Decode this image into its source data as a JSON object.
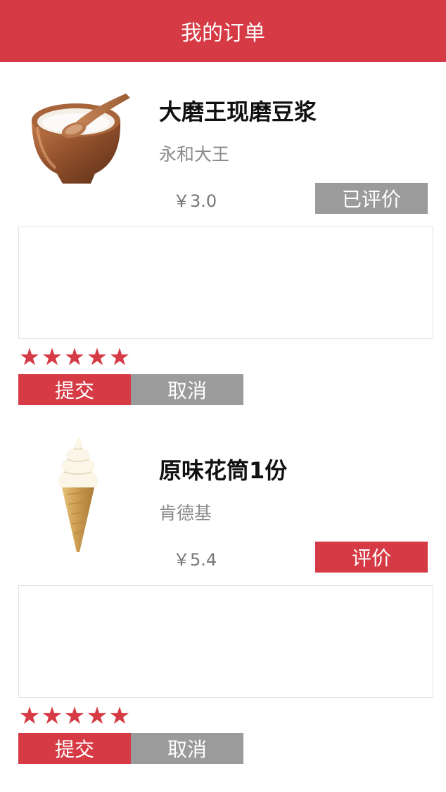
{
  "header": {
    "title": "我的订单"
  },
  "orders": [
    {
      "name": "大磨王现磨豆浆",
      "shop": "永和大王",
      "price": "￥3.0",
      "review_button": "已评价",
      "review_state": "reviewed",
      "comment_value": "",
      "rating": 5,
      "stars": [
        "★",
        "★",
        "★",
        "★",
        "★"
      ],
      "submit_label": "提交",
      "cancel_label": "取消",
      "image_icon": "soy-milk-bowl-image"
    },
    {
      "name": "原味花筒1份",
      "shop": "肯德基",
      "price": "￥5.4",
      "review_button": "评价",
      "review_state": "pending",
      "comment_value": "",
      "rating": 5,
      "stars": [
        "★",
        "★",
        "★",
        "★",
        "★"
      ],
      "submit_label": "提交",
      "cancel_label": "取消",
      "image_icon": "ice-cream-cone-image"
    }
  ],
  "colors": {
    "accent": "#d63a45",
    "muted_button": "#9b9b9b",
    "text_secondary": "#8a8a8a"
  }
}
